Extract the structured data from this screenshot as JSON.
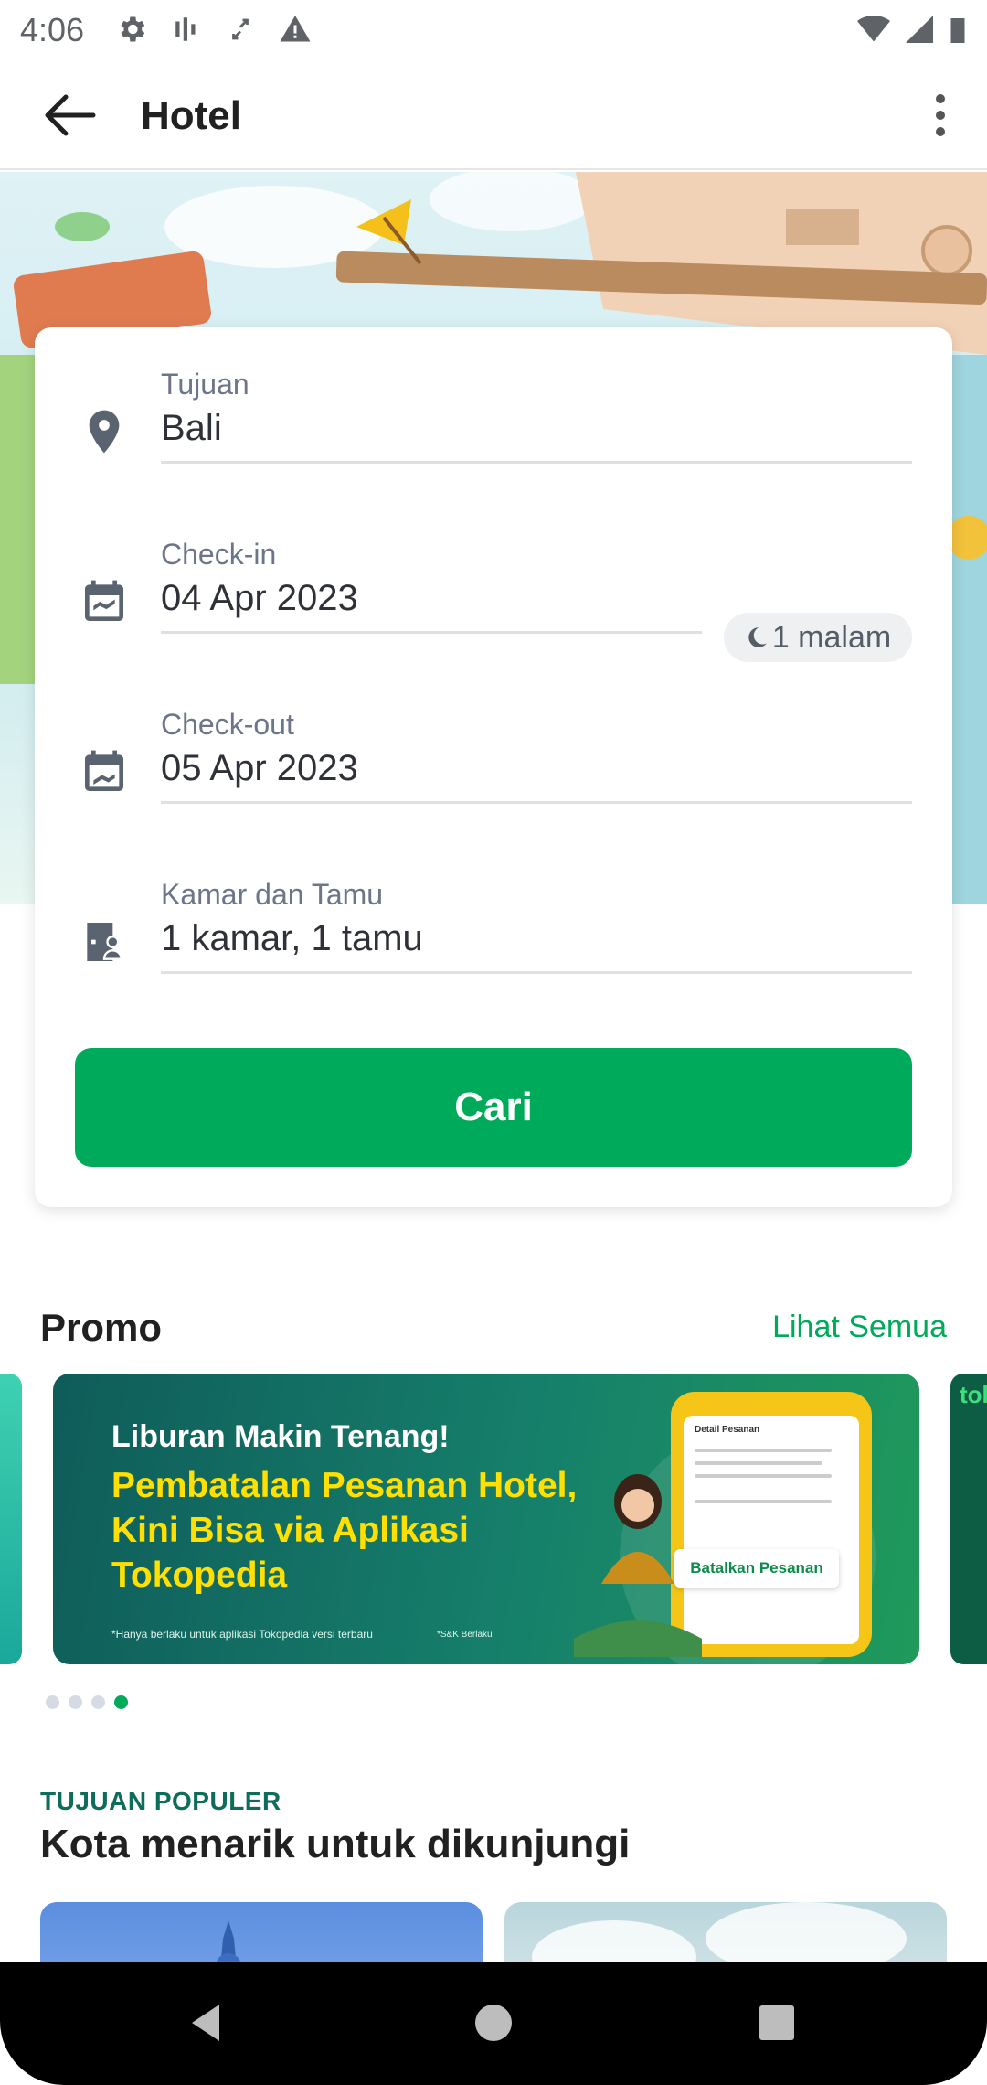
{
  "status_bar": {
    "time": "4:06",
    "icons_left": [
      "settings-icon",
      "signal-bars-icon",
      "data-arrows-icon",
      "warning-icon"
    ],
    "icons_right": [
      "wifi-icon",
      "cellular-icon",
      "battery-icon"
    ]
  },
  "app_bar": {
    "title": "Hotel",
    "back_icon": "arrow-back-icon",
    "menu_icon": "more-vert-icon"
  },
  "search_form": {
    "destination": {
      "label": "Tujuan",
      "value": "Bali",
      "icon": "location-pin-icon"
    },
    "checkin": {
      "label": "Check-in",
      "value": "04 Apr 2023",
      "icon": "calendar-checkin-icon"
    },
    "nights": "1 malam",
    "checkout": {
      "label": "Check-out",
      "value": "05 Apr 2023",
      "icon": "calendar-checkout-icon"
    },
    "rooms_guests": {
      "label": "Kamar dan Tamu",
      "value": "1 kamar, 1 tamu",
      "icon": "room-guest-icon"
    },
    "search_button": "Cari"
  },
  "promo": {
    "title": "Promo",
    "see_all": "Lihat Semua",
    "banner": {
      "headline": "Liburan Makin Tenang!",
      "subheadline": "Pembatalan Pesanan Hotel, Kini Bisa via Aplikasi Tokopedia",
      "footnote": "*Hanya berlaku untuk aplikasi Tokopedia versi terbaru",
      "terms": "*S&K Berlaku",
      "phone_header": "Detail Pesanan",
      "cta": "Batalkan Pesanan"
    },
    "next_banner_peek": "tol",
    "carousel": {
      "total": 4,
      "active_index": 3
    }
  },
  "popular": {
    "kicker": "TUJUAN POPULER",
    "title": "Kota menarik untuk dikunjungi"
  },
  "colors": {
    "primary_green": "#00aa5b",
    "text_dark": "#212121",
    "label_gray": "#6d7588"
  }
}
